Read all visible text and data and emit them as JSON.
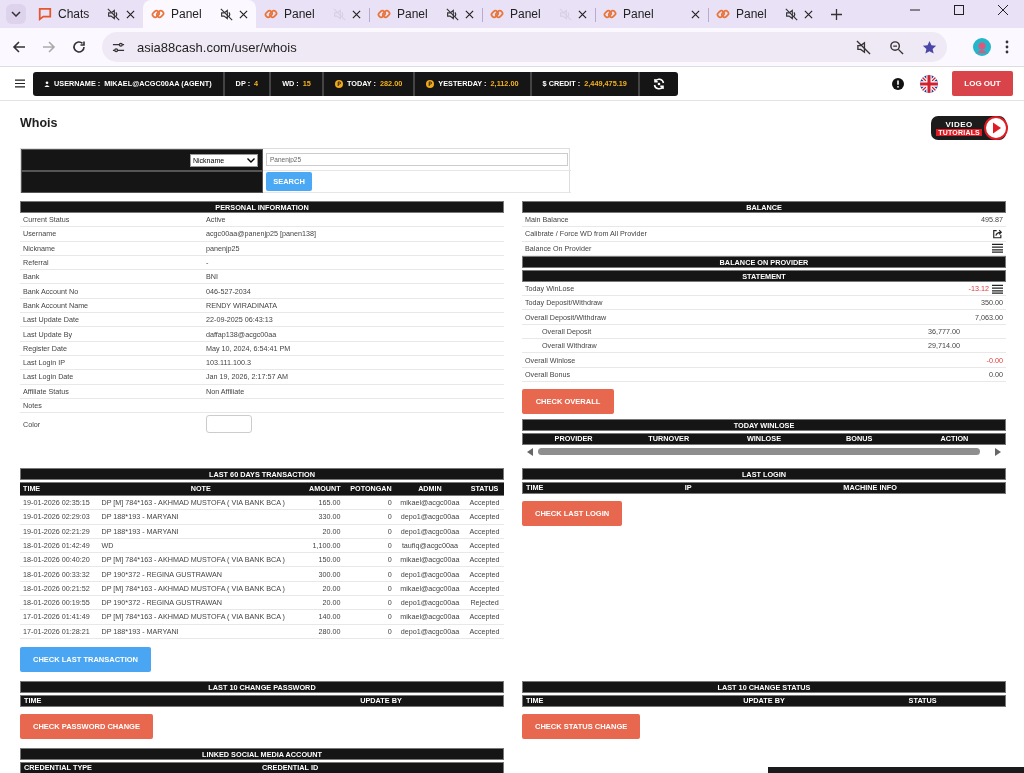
{
  "browser": {
    "tabs": [
      {
        "label": "Chats",
        "kind": "chat",
        "muted": true,
        "dimmed": false,
        "selected": false
      },
      {
        "label": "Panel",
        "kind": "link",
        "muted": true,
        "dimmed": false,
        "selected": true
      },
      {
        "label": "Panel",
        "kind": "link",
        "muted": true,
        "dimmed": true,
        "selected": false
      },
      {
        "label": "Panel",
        "kind": "link",
        "muted": true,
        "dimmed": false,
        "selected": false
      },
      {
        "label": "Panel",
        "kind": "link",
        "muted": true,
        "dimmed": true,
        "selected": false
      },
      {
        "label": "Panel",
        "kind": "link",
        "muted": false,
        "selected": false
      },
      {
        "label": "Panel",
        "kind": "link",
        "muted": true,
        "dimmed": false,
        "selected": false
      }
    ],
    "url": "asia88cash.com/user/whois"
  },
  "topbar": {
    "stats": [
      {
        "label": "USERNAME :",
        "value": "MIKAEL@ACGC00AA (AGENT)",
        "kind": "user",
        "highlight": false
      },
      {
        "label": "DP :",
        "value": "4",
        "kind": "plain",
        "highlight": true
      },
      {
        "label": "WD :",
        "value": "15",
        "kind": "plain",
        "highlight": true
      },
      {
        "label": "TODAY :",
        "value": "282.00",
        "kind": "coin",
        "highlight": true
      },
      {
        "label": "YESTERDAY :",
        "value": "2,112.00",
        "kind": "coin",
        "highlight": true
      },
      {
        "label": "$ CREDIT :",
        "value": "2,449,475.19",
        "kind": "plain",
        "highlight": true
      }
    ],
    "logout": "LOG OUT"
  },
  "page": {
    "title": "Whois",
    "video_badge": {
      "line1": "VIDEO",
      "line2": "TUTORIALS"
    },
    "search": {
      "field": "Nickname",
      "value": "Panenjp25",
      "button": "SEARCH"
    },
    "personal": {
      "title": "PERSONAL INFORMATION",
      "rows": [
        {
          "kind": "text",
          "label": "Current Status",
          "value": "Active"
        },
        {
          "kind": "text",
          "label": "Username",
          "value": "acgc00aa@panenjp25  [panen138]"
        },
        {
          "kind": "text",
          "label": "Nickname",
          "value": "panenjp25"
        },
        {
          "kind": "text",
          "label": "Referral",
          "value": "-"
        },
        {
          "kind": "text",
          "label": "Bank",
          "value": "BNI"
        },
        {
          "kind": "text",
          "label": "Bank Account No",
          "value": "046-527-2034"
        },
        {
          "kind": "text",
          "label": "Bank Account Name",
          "value": "RENDY WIRADINATA"
        },
        {
          "kind": "text",
          "label": "Last Update Date",
          "value": "22-09-2025 06:43:13"
        },
        {
          "kind": "text",
          "label": "Last Update By",
          "value": "daffap138@acgc00aa"
        },
        {
          "kind": "text",
          "label": "Register Date",
          "value": "May 10, 2024, 6:54:41 PM"
        },
        {
          "kind": "text",
          "label": "Last Login IP",
          "value": "103.111.100.3"
        },
        {
          "kind": "text",
          "label": "Last Login Date",
          "value": "Jan 19, 2026, 2:17:57 AM"
        },
        {
          "kind": "text",
          "label": "Affiliate Status",
          "value": "Non Affiliate"
        },
        {
          "kind": "text",
          "label": "Notes"
        },
        {
          "kind": "color",
          "label": "Color"
        }
      ]
    },
    "balance": {
      "title": "BALANCE",
      "rows": [
        {
          "kind": "value",
          "label": "Main Balance",
          "value": "495.87"
        },
        {
          "kind": "export",
          "label": "Calibrate / Force WD from All Provider"
        },
        {
          "kind": "list",
          "label": "Balance On Provider"
        }
      ],
      "provider_title": "BALANCE ON PROVIDER"
    },
    "statement": {
      "title": "STATEMENT",
      "rows": [
        {
          "kind": "main_list",
          "label": "Today WinLose",
          "value": "-13.12",
          "negative": true
        },
        {
          "kind": "main",
          "label": "Today Deposit/Withdraw",
          "value": "350.00",
          "negative": false
        },
        {
          "kind": "main",
          "label": "Overall Deposit/Withdraw",
          "value": "7,063.00",
          "negative": false
        },
        {
          "kind": "sub",
          "label": "Overall Deposit",
          "value": "36,777.00",
          "negative": false
        },
        {
          "kind": "sub",
          "label": "Overall Withdraw",
          "value": "29,714.00",
          "negative": false
        },
        {
          "kind": "main",
          "label": "Overall Winlose",
          "value": "-0.00",
          "negative": true
        },
        {
          "kind": "main",
          "label": "Overall Bonus",
          "value": "0.00",
          "negative": false
        }
      ],
      "button": "CHECK OVERALL"
    },
    "today_winlose": {
      "title": "TODAY WINLOSE",
      "columns": [
        "PROVIDER",
        "TURNOVER",
        "WINLOSE",
        "BONUS",
        "ACTION"
      ]
    },
    "transactions": {
      "title": "LAST 60 DAYS TRANSACTION",
      "columns": [
        "TIME",
        "NOTE",
        "AMOUNT",
        "POTONGAN",
        "ADMIN",
        "STATUS"
      ],
      "rows": [
        [
          "19-01-2026 02:35:15",
          "DP [M] 784*163 - AKHMAD MUSTOFA ( VIA BANK BCA )",
          "165.00",
          "0",
          "mikael@acgc00aa",
          "Accepted"
        ],
        [
          "19-01-2026 02:29:03",
          "DP 188*193 - MARYANI",
          "330.00",
          "0",
          "depo1@acgc00aa",
          "Accepted"
        ],
        [
          "19-01-2026 02:21:29",
          "DP 188*193 - MARYANI",
          "20.00",
          "0",
          "depo1@acgc00aa",
          "Accepted"
        ],
        [
          "18-01-2026 01:42:49",
          "WD",
          "1,100.00",
          "0",
          "taufiq@acgc00aa",
          "Accepted"
        ],
        [
          "18-01-2026 00:40:20",
          "DP [M] 784*163 - AKHMAD MUSTOFA ( VIA BANK BCA )",
          "150.00",
          "0",
          "mikael@acgc00aa",
          "Accepted"
        ],
        [
          "18-01-2026 00:33:32",
          "DP 190*372 - REGINA GUSTRAWAN",
          "300.00",
          "0",
          "depo1@acgc00aa",
          "Accepted"
        ],
        [
          "18-01-2026 00:21:52",
          "DP [M] 784*163 - AKHMAD MUSTOFA ( VIA BANK BCA )",
          "20.00",
          "0",
          "mikael@acgc00aa",
          "Accepted"
        ],
        [
          "18-01-2026 00:19:55",
          "DP 190*372 - REGINA GUSTRAWAN",
          "20.00",
          "0",
          "depo1@acgc00aa",
          "Rejected"
        ],
        [
          "17-01-2026 01:41:49",
          "DP [M] 784*163 - AKHMAD MUSTOFA ( VIA BANK BCA )",
          "140.00",
          "0",
          "mikael@acgc00aa",
          "Accepted"
        ],
        [
          "17-01-2026 01:28:21",
          "DP 188*193 - MARYANI",
          "280.00",
          "0",
          "depo1@acgc00aa",
          "Accepted"
        ]
      ],
      "button": "CHECK LAST TRANSACTION"
    },
    "last_login": {
      "title": "LAST LOGIN",
      "columns": [
        "TIME",
        "IP",
        "MACHINE INFO"
      ],
      "button": "CHECK LAST LOGIN"
    },
    "password_changes": {
      "title": "LAST 10 CHANGE PASSWORD",
      "columns": [
        "TIME",
        "UPDATE BY"
      ],
      "button": "CHECK PASSWORD CHANGE"
    },
    "status_changes": {
      "title": "LAST 10 CHANGE STATUS",
      "columns": [
        "TIME",
        "UPDATE BY",
        "STATUS"
      ],
      "button": "CHECK STATUS CHANGE"
    },
    "social": {
      "title": "LINKED SOCIAL MEDIA ACCOUNT",
      "columns": [
        "CREDENTIAL TYPE",
        "CREDENTIAL ID"
      ]
    }
  }
}
